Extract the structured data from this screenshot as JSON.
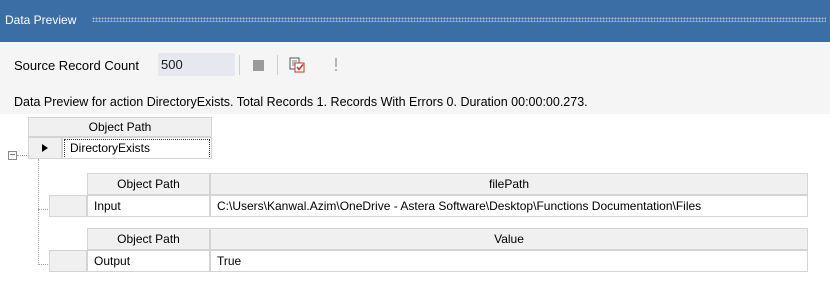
{
  "panel": {
    "title": "Data Preview"
  },
  "toolbar": {
    "source_label": "Source Record Count",
    "source_value": "500",
    "stop_icon": "stop-icon",
    "preview_icon": "preview-check-icon",
    "exclaim_icon": "exclamation-icon"
  },
  "status": {
    "text": "Data Preview for action DirectoryExists. Total Records 1. Records With Errors 0. Duration 00:00:00.273."
  },
  "grid": {
    "top_header": "Object Path",
    "top_value": "DirectoryExists",
    "input_table": {
      "headers": [
        "Object Path",
        "filePath"
      ],
      "row": [
        "Input",
        "C:\\Users\\Kanwal.Azim\\OneDrive - Astera Software\\Desktop\\Functions Documentation\\Files"
      ]
    },
    "output_table": {
      "headers": [
        "Object Path",
        "Value"
      ],
      "row": [
        "Output",
        "True"
      ]
    }
  },
  "colors": {
    "titlebar": "#3c6ea6",
    "toolbar_bg": "#f5f5f5",
    "input_bg": "#e5e9ef"
  }
}
